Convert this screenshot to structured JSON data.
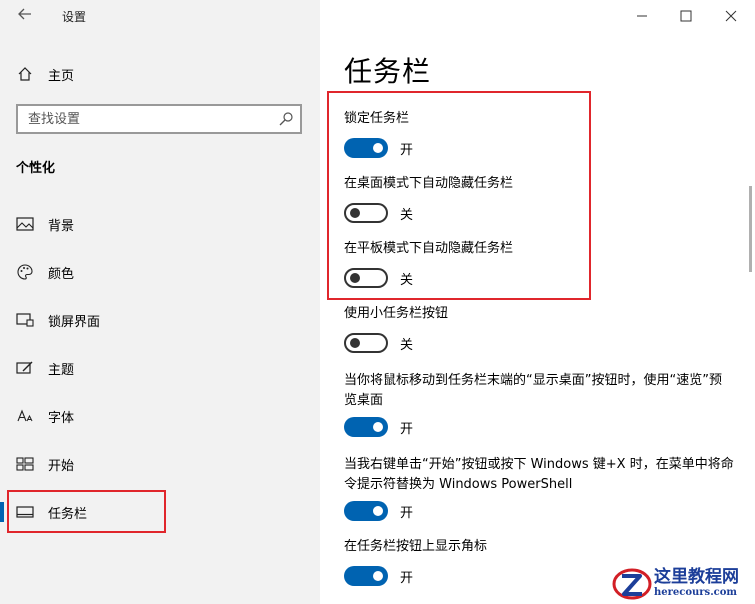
{
  "window": {
    "title": "设置",
    "controls": [
      "minimize-icon",
      "maximize-icon",
      "close-icon"
    ]
  },
  "sidebar": {
    "home_label": "主页",
    "search_placeholder": "查找设置",
    "section_heading": "个性化",
    "items": [
      {
        "label": "背景",
        "icon": "picture-icon",
        "active": false
      },
      {
        "label": "颜色",
        "icon": "palette-icon",
        "active": false
      },
      {
        "label": "锁屏界面",
        "icon": "lock-screen-icon",
        "active": false
      },
      {
        "label": "主题",
        "icon": "theme-brush-icon",
        "active": false
      },
      {
        "label": "字体",
        "icon": "font-icon",
        "active": false
      },
      {
        "label": "开始",
        "icon": "start-grid-icon",
        "active": false
      },
      {
        "label": "任务栏",
        "icon": "taskbar-icon",
        "active": true
      }
    ]
  },
  "main": {
    "page_title": "任务栏",
    "settings": [
      {
        "label": "锁定任务栏",
        "state": "开",
        "on": true
      },
      {
        "label": "在桌面模式下自动隐藏任务栏",
        "state": "关",
        "on": false
      },
      {
        "label": "在平板模式下自动隐藏任务栏",
        "state": "关",
        "on": false
      },
      {
        "label": "使用小任务栏按钮",
        "state": "关",
        "on": false
      },
      {
        "label": "当你将鼠标移动到任务栏末端的“显示桌面”按钮时，使用“速览”预览桌面",
        "state": "开",
        "on": true
      },
      {
        "label": "当我右键单击“开始”按钮或按下 Windows 键+X 时，在菜单中将命令提示符替换为 Windows PowerShell",
        "state": "开",
        "on": true
      },
      {
        "label": "在任务栏按钮上显示角标",
        "state": "开",
        "on": true
      }
    ]
  },
  "watermark": {
    "name": "这里教程网",
    "url": "herecours.com"
  },
  "colors": {
    "accent": "#0063b1",
    "highlight_border": "#e0262c",
    "sidebar_bg": "#f2f2f2"
  }
}
